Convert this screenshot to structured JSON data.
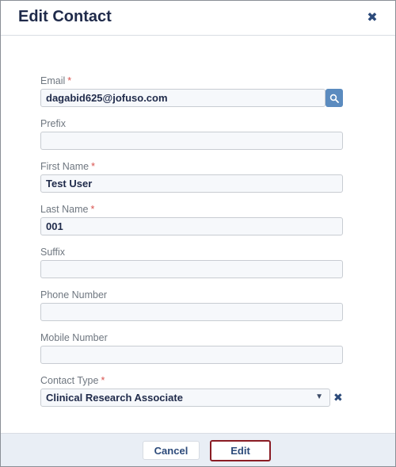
{
  "dialog": {
    "title": "Edit Contact",
    "close_icon": "close-icon"
  },
  "fields": {
    "email": {
      "label": "Email",
      "required_mark": "*",
      "value": "dagabid625@jofuso.com"
    },
    "prefix": {
      "label": "Prefix",
      "value": ""
    },
    "first_name": {
      "label": "First Name",
      "required_mark": "*",
      "value": "Test User"
    },
    "last_name": {
      "label": "Last Name",
      "required_mark": "*",
      "value": "001"
    },
    "suffix": {
      "label": "Suffix",
      "value": ""
    },
    "phone": {
      "label": "Phone Number",
      "value": ""
    },
    "mobile": {
      "label": "Mobile Number",
      "value": ""
    },
    "contact_type": {
      "label": "Contact Type",
      "required_mark": "*",
      "value": "Clinical Research Associate"
    }
  },
  "footer": {
    "cancel_label": "Cancel",
    "edit_label": "Edit"
  },
  "colors": {
    "title": "#1f2a4a",
    "required": "#d9534f",
    "search_button": "#5b8bbf",
    "edit_outline": "#8a1c24"
  }
}
